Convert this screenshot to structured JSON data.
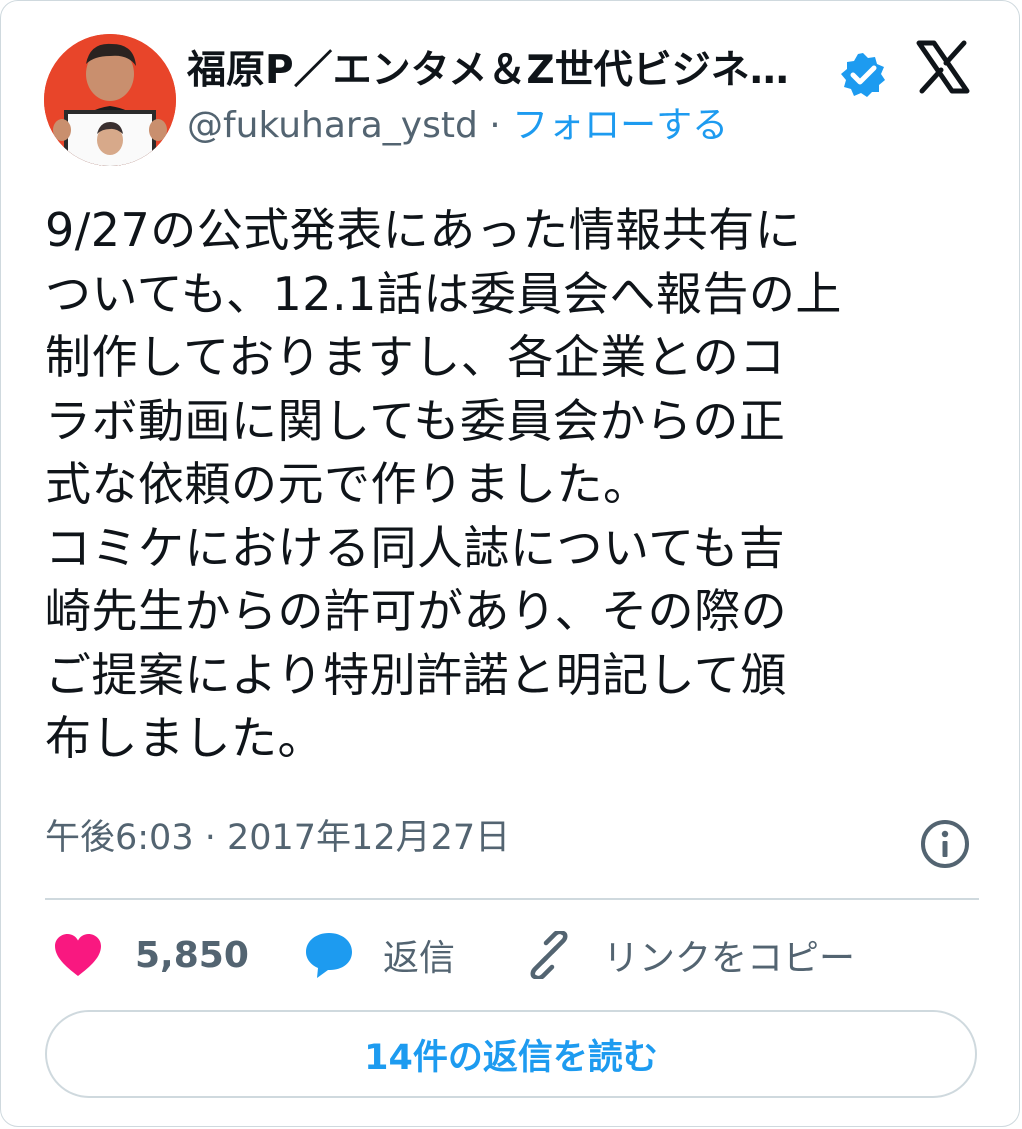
{
  "author": {
    "display_name": "福原P／エンタメ＆Z世代ビジネ…",
    "handle": "@fukuhara_ystd",
    "separator": "·",
    "follow_label": "フォローする",
    "verified_icon": "verified-badge-icon",
    "avatar_icon": "avatar"
  },
  "platform": {
    "logo_icon": "x-logo-icon"
  },
  "tweet": {
    "text": "9/27の公式発表にあった情報共有に\nついても、12.1話は委員会へ報告の上\n制作しておりますし、各企業とのコ\nラボ動画に関しても委員会からの正\n式な依頼の元で作りました。\nコミケにおける同人誌についても吉\n崎先生からの許可があり、その際の\nご提案により特別許諾と明記して頒\n布しました。",
    "timestamp": "午後6:03 · 2017年12月27日"
  },
  "actions": {
    "like_count": "5,850",
    "reply_label": "返信",
    "copy_link_label": "リンクをコピー"
  },
  "footer": {
    "read_replies_label": "14件の返信を読む"
  },
  "colors": {
    "accent": "#1d9bf0",
    "like": "#f91880",
    "text": "#0f1419",
    "secondary": "#536471",
    "border": "#cfd9de"
  }
}
